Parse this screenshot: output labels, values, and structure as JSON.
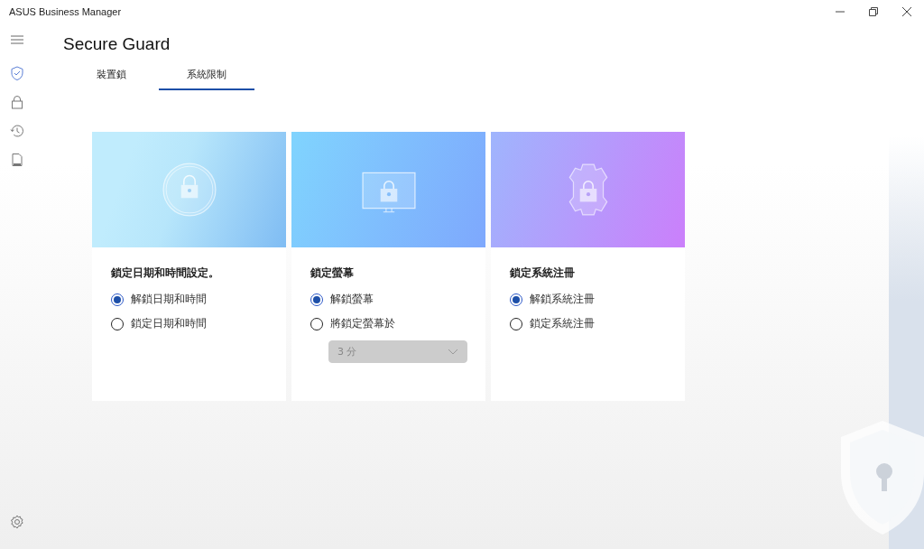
{
  "window": {
    "title": "ASUS Business Manager"
  },
  "sidebar": {
    "items": [
      {
        "selected": true
      },
      {
        "selected": false
      },
      {
        "selected": false
      },
      {
        "selected": false
      }
    ]
  },
  "page": {
    "title": "Secure Guard"
  },
  "tabs": [
    {
      "label": "裝置鎖",
      "selected": false
    },
    {
      "label": "系統限制",
      "selected": true
    }
  ],
  "cards": [
    {
      "kind": "clock",
      "title": "鎖定日期和時間設定。",
      "options": [
        {
          "label": "解鎖日期和時間",
          "selected": true
        },
        {
          "label": "鎖定日期和時間",
          "selected": false
        }
      ]
    },
    {
      "kind": "monitor",
      "title": "鎖定螢幕",
      "options": [
        {
          "label": "解鎖螢幕",
          "selected": true
        },
        {
          "label": "將鎖定螢幕於",
          "selected": false
        }
      ],
      "dropdown": {
        "value": "3 分",
        "disabled": true
      }
    },
    {
      "kind": "gear",
      "title": "鎖定系統注冊",
      "options": [
        {
          "label": "解鎖系統注冊",
          "selected": true
        },
        {
          "label": "鎖定系統注冊",
          "selected": false
        }
      ]
    }
  ]
}
